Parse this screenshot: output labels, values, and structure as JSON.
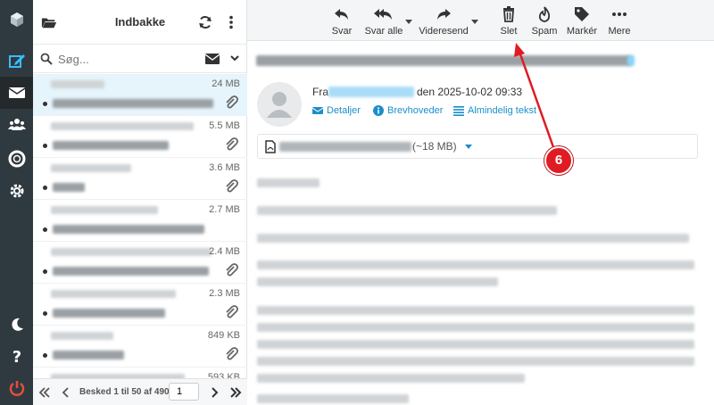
{
  "sidebar": {
    "items": [
      {
        "name": "logo"
      },
      {
        "name": "compose"
      },
      {
        "name": "mail"
      },
      {
        "name": "contacts"
      },
      {
        "name": "help-lifebuoy"
      },
      {
        "name": "settings"
      }
    ],
    "bottom": [
      {
        "name": "dark-mode"
      },
      {
        "name": "about"
      },
      {
        "name": "logout"
      }
    ],
    "accent": "#37beff",
    "logout_color": "#e74c3c"
  },
  "list": {
    "title": "Indbakke",
    "search_placeholder": "Søg...",
    "messages": [
      {
        "size": "24 MB",
        "unread": true,
        "attachment": true,
        "selected": true
      },
      {
        "size": "5.5 MB",
        "unread": true,
        "attachment": true
      },
      {
        "size": "3.6 MB",
        "unread": true,
        "attachment": true
      },
      {
        "size": "2.7 MB",
        "unread": true,
        "attachment": false
      },
      {
        "size": "2.4 MB",
        "unread": true,
        "attachment": true
      },
      {
        "size": "2.3 MB",
        "unread": true,
        "attachment": true
      },
      {
        "size": "849 KB",
        "unread": true,
        "attachment": true
      },
      {
        "size": "593 KB",
        "unread": true,
        "attachment": false
      }
    ],
    "pager": {
      "text": "Besked 1 til 50 af 490",
      "page": "1"
    }
  },
  "toolbar": {
    "reply": "Svar",
    "reply_all": "Svar alle",
    "forward": "Videresend",
    "delete": "Slet",
    "spam": "Spam",
    "mark": "Markér",
    "more": "Mere"
  },
  "message": {
    "from_label": "Fra",
    "date": "den 2025-10-02 09:33",
    "links": {
      "details": "Detaljer",
      "headers": "Brevhoveder",
      "plain": "Almindelig tekst"
    },
    "attachment_size": "(~18 MB)"
  },
  "annotation": {
    "number": "6"
  }
}
